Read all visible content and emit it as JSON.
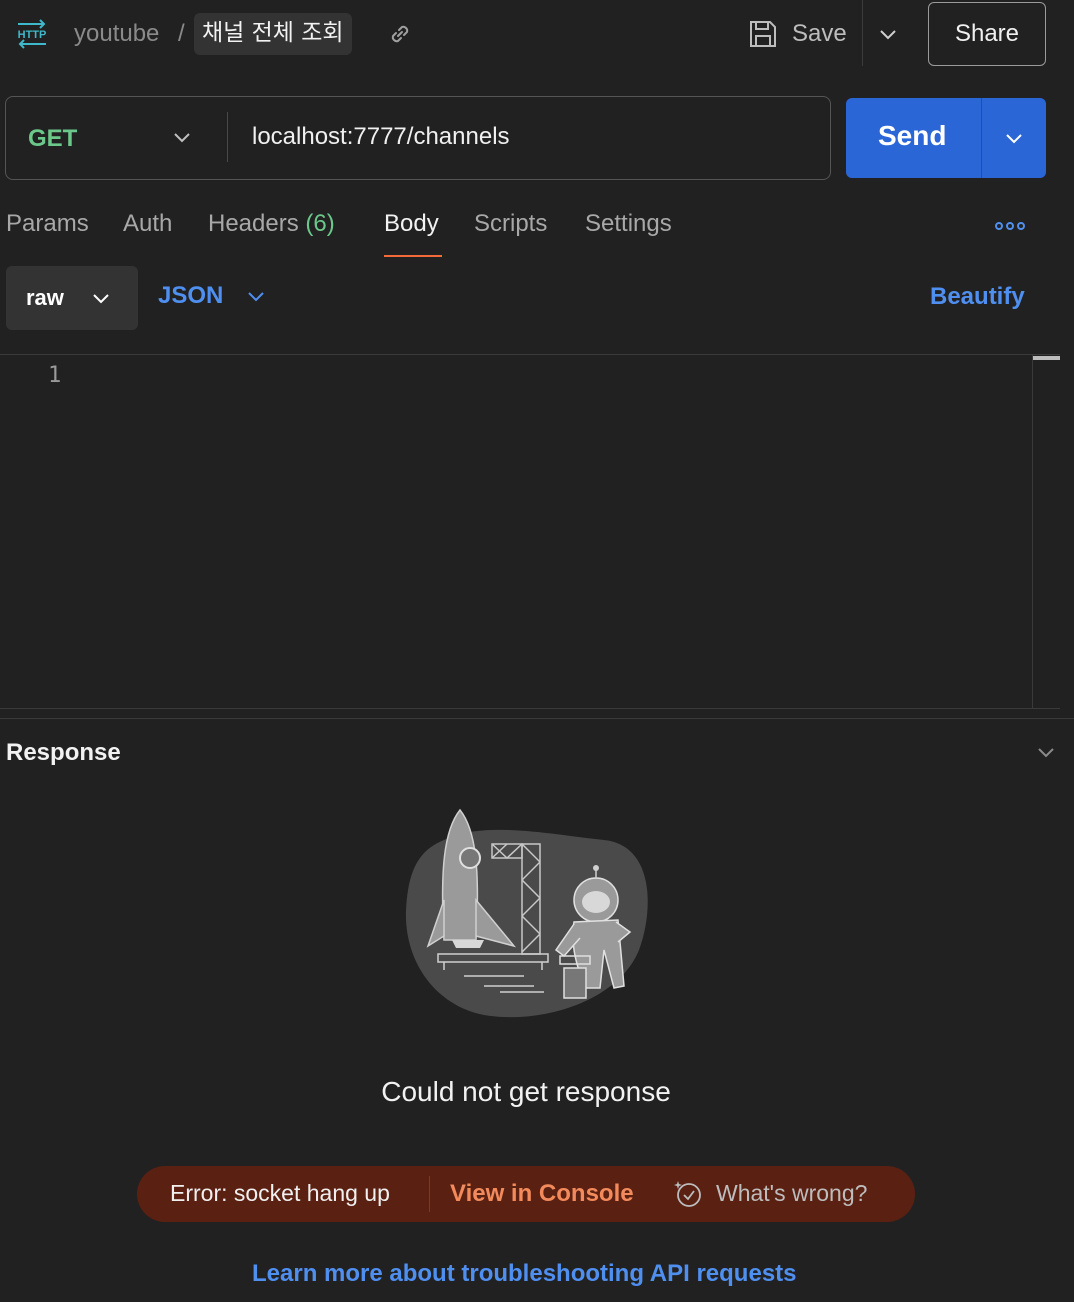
{
  "header": {
    "http_icon_text": "HTTP",
    "collection": "youtube",
    "separator": "/",
    "request_name": "채널 전체 조회",
    "save_label": "Save",
    "share_label": "Share"
  },
  "request": {
    "method": "GET",
    "url": "localhost:7777/channels",
    "send_label": "Send"
  },
  "tabs": {
    "params": "Params",
    "auth": "Auth",
    "headers": "Headers",
    "headers_count": "(6)",
    "body": "Body",
    "scripts": "Scripts",
    "settings": "Settings",
    "active": "Body"
  },
  "body_options": {
    "mode": "raw",
    "language": "JSON",
    "beautify_label": "Beautify"
  },
  "editor": {
    "line_numbers": [
      "1"
    ],
    "content": ""
  },
  "response": {
    "title": "Response",
    "message": "Could not get response",
    "error_text": "Error: socket hang up",
    "view_console_label": "View in Console",
    "whats_wrong_label": "What's wrong?",
    "learn_more_label": "Learn more about troubleshooting API requests"
  },
  "colors": {
    "background": "#212121",
    "method_get": "#6cc78a",
    "send_button": "#2b66d6",
    "link_blue": "#4f8ff0",
    "tab_underline": "#f26b3a",
    "error_bg": "#5a2012",
    "console_orange": "#f28a5c"
  },
  "icons": {
    "http": "http-icon",
    "link": "link-icon",
    "save": "floppy-disk-icon",
    "more": "more-dots-icon",
    "whats_wrong": "sparkle-help-icon"
  }
}
